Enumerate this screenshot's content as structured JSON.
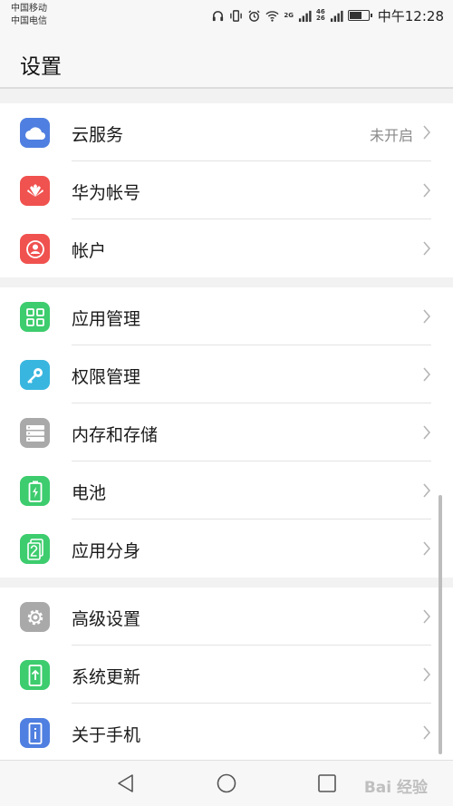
{
  "status_bar": {
    "carrier_1": "中国移动",
    "carrier_2": "中国电信",
    "net_1_top": "2G",
    "net_2_top": "4G",
    "net_2_bottom": "2G",
    "net_3_top": "46",
    "net_3_bottom": "26",
    "time": "中午12:28"
  },
  "header": {
    "title": "设置"
  },
  "groups": [
    {
      "items": [
        {
          "label": "云服务",
          "value": "未开启",
          "icon": "cloud-icon",
          "color": "#4f7fe0"
        },
        {
          "label": "华为帐号",
          "value": "",
          "icon": "huawei-logo-icon",
          "color": "#f0524f"
        },
        {
          "label": "帐户",
          "value": "",
          "icon": "user-icon",
          "color": "#f0524f"
        }
      ]
    },
    {
      "items": [
        {
          "label": "应用管理",
          "value": "",
          "icon": "apps-grid-icon",
          "color": "#3dcc6e"
        },
        {
          "label": "权限管理",
          "value": "",
          "icon": "key-icon",
          "color": "#39b6df"
        },
        {
          "label": "内存和存储",
          "value": "",
          "icon": "storage-icon",
          "color": "#a9a9a9"
        },
        {
          "label": "电池",
          "value": "",
          "icon": "battery-icon",
          "color": "#3dcc6e"
        },
        {
          "label": "应用分身",
          "value": "",
          "icon": "app-twin-icon",
          "color": "#3dcc6e"
        }
      ]
    },
    {
      "items": [
        {
          "label": "高级设置",
          "value": "",
          "icon": "gear-icon",
          "color": "#a9a9a9"
        },
        {
          "label": "系统更新",
          "value": "",
          "icon": "system-update-icon",
          "color": "#3dcc6e"
        },
        {
          "label": "关于手机",
          "value": "",
          "icon": "info-icon",
          "color": "#4f7fe0"
        }
      ]
    }
  ],
  "navbar": {
    "back": "back-triangle-icon",
    "home": "home-circle-icon",
    "recents": "recents-square-icon",
    "watermark": "Bai 经验"
  }
}
